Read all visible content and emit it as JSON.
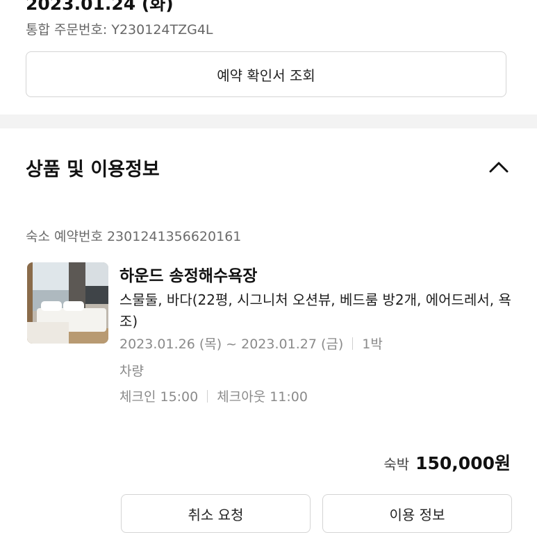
{
  "order": {
    "date": "2023.01.24 (화)",
    "number_text": "통합 주문번호: Y230124TZG4L",
    "confirm_button": "예약 확인서 조회"
  },
  "section": {
    "title": "상품 및 이용정보",
    "toggle_icon": "chevron-up-icon"
  },
  "reservation": {
    "number_text": "숙소 예약번호 2301241356620161",
    "product_name": "하운드 송정해수욕장",
    "room_description": "스물둘, 바다(22평, 시그니처 오션뷰, 베드룸 방2개, 에어드레서, 욕조)",
    "dates": "2023.01.26 (목) ~ 2023.01.27 (금)",
    "nights": "1박",
    "parking": "차량",
    "checkin": "체크인 15:00",
    "checkout": "체크아웃 11:00"
  },
  "price": {
    "label": "숙박",
    "value": "150,000원"
  },
  "actions": {
    "cancel_label": "취소 요청",
    "info_label": "이용 정보"
  }
}
